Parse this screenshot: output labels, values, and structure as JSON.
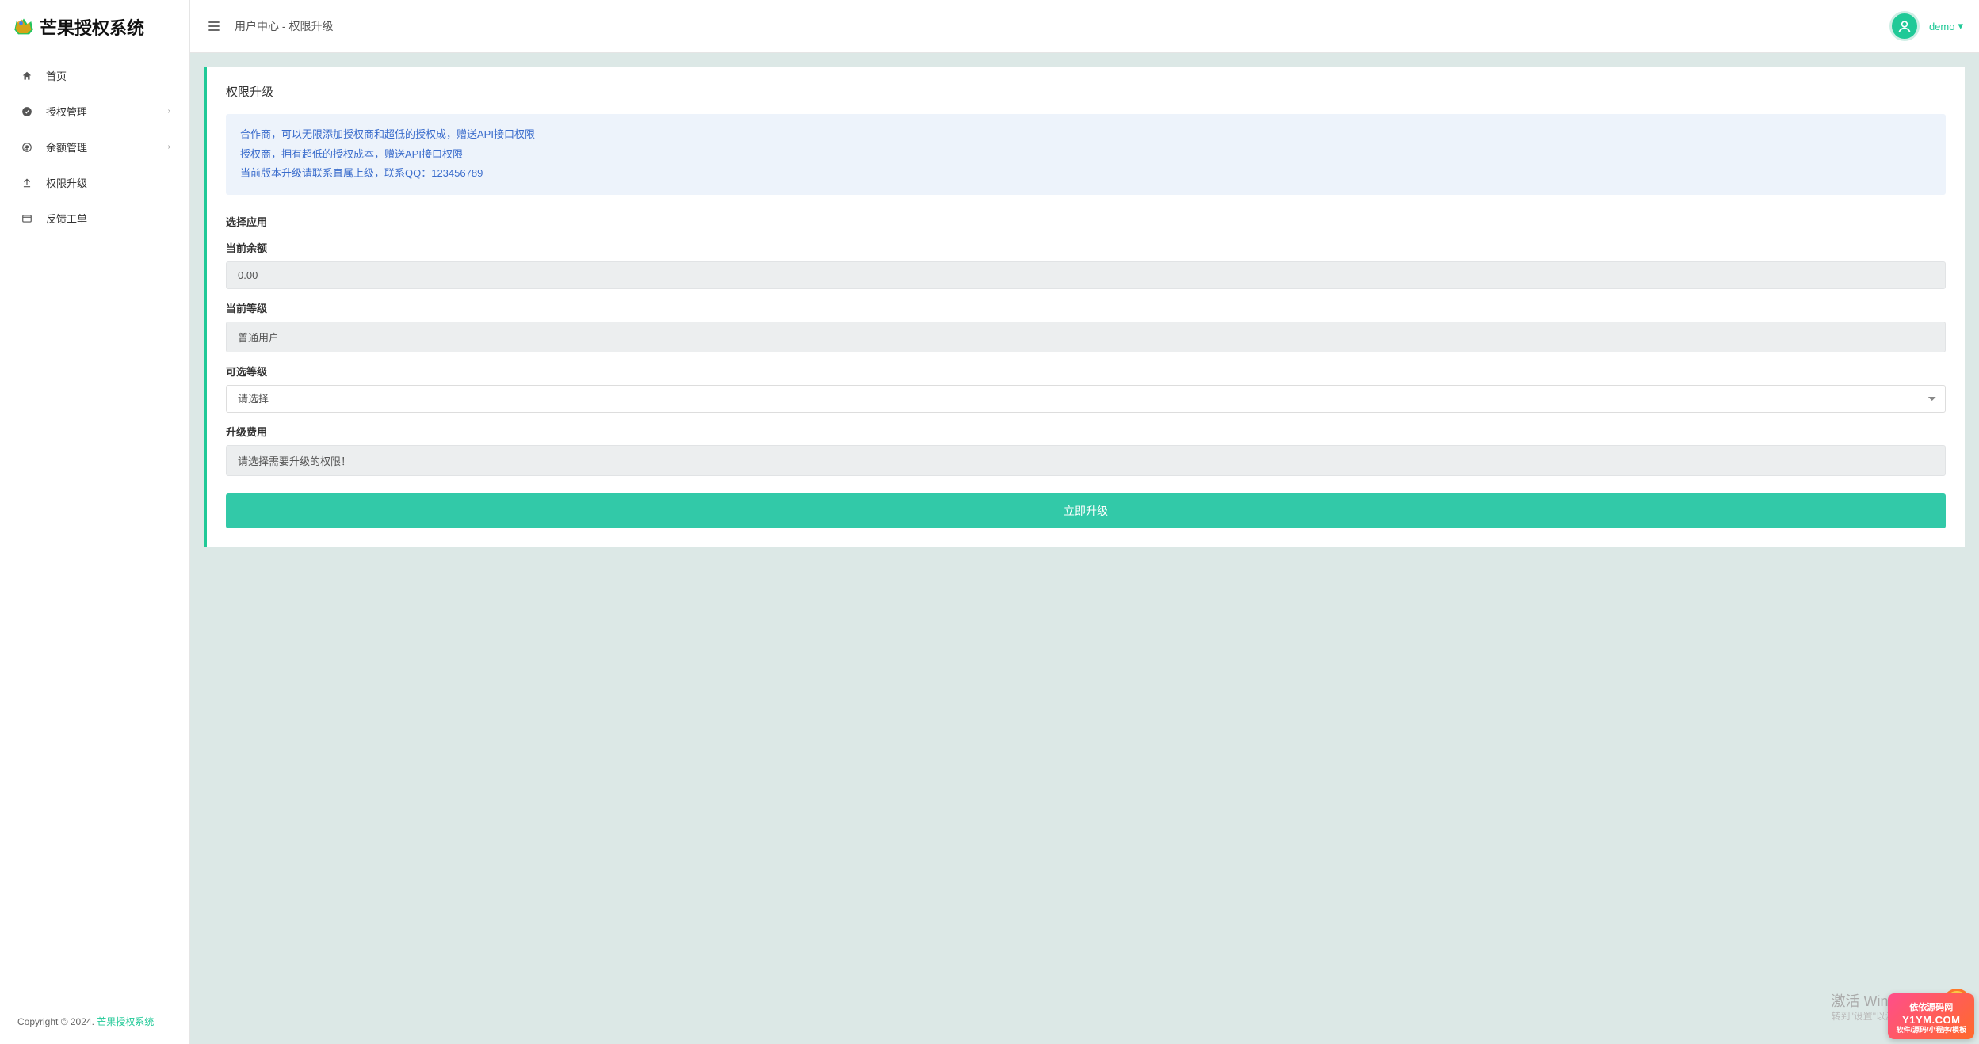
{
  "app": {
    "name": "芒果授权系统"
  },
  "header": {
    "breadcrumb": "用户中心 - 权限升级",
    "user": "demo"
  },
  "sidebar": {
    "items": [
      {
        "label": "首页",
        "icon": "home-icon",
        "hasChildren": false
      },
      {
        "label": "授权管理",
        "icon": "check-icon",
        "hasChildren": true
      },
      {
        "label": "余额管理",
        "icon": "dollar-icon",
        "hasChildren": true
      },
      {
        "label": "权限升级",
        "icon": "upgrade-icon",
        "hasChildren": false
      },
      {
        "label": "反馈工单",
        "icon": "ticket-icon",
        "hasChildren": false
      }
    ],
    "copyright_prefix": "Copyright © 2024. ",
    "copyright_link": "芒果授权系统"
  },
  "card": {
    "title": "权限升级",
    "notice_line1": "合作商，可以无限添加授权商和超低的授权成，赠送API接口权限",
    "notice_line2": "授权商，拥有超低的授权成本，赠送API接口权限",
    "notice_line3": "当前版本升级请联系直属上级，联系QQ：123456789",
    "section_select_app": "选择应用",
    "balance_label": "当前余额",
    "balance_value": "0.00",
    "level_label": "当前等级",
    "level_value": "普通用户",
    "options_label": "可选等级",
    "options_placeholder": "请选择",
    "cost_label": "升级费用",
    "cost_value": "请选择需要升级的权限！",
    "submit_label": "立即升级"
  },
  "watermark": {
    "title": "激活 Windows",
    "sub": "转到\"设置\"以激活 Windows。"
  },
  "corner": {
    "title": "依依源码网",
    "domain": "Y1YM.COM",
    "sub": "软件/源码/小程序/模板"
  }
}
